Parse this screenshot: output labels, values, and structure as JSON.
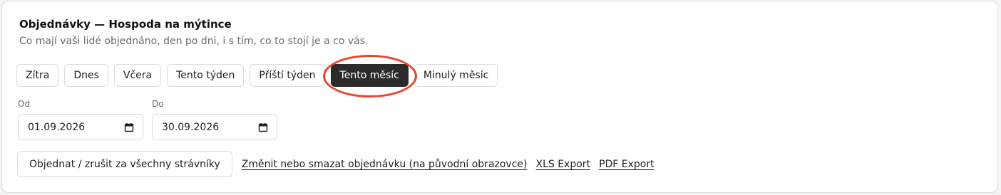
{
  "header": {
    "title": "Objednávky — Hospoda na mýtince",
    "subtitle": "Co mají vaši lidé objednáno, den po dni, i s tím, co to stojí je a co vás."
  },
  "presets": [
    {
      "label": "Zítra",
      "active": false
    },
    {
      "label": "Dnes",
      "active": false
    },
    {
      "label": "Včera",
      "active": false
    },
    {
      "label": "Tento týden",
      "active": false
    },
    {
      "label": "Příští týden",
      "active": false
    },
    {
      "label": "Tento měsíc",
      "active": true
    },
    {
      "label": "Minulý měsíc",
      "active": false
    }
  ],
  "date_range": {
    "from_label": "Od",
    "from_value": "01.09.2026",
    "to_label": "Do",
    "to_value": "30.09.2026"
  },
  "actions": {
    "order_all_label": "Objednat / zrušit za všechny strávníky",
    "change_link": "Změnit nebo smazat objednávku (na původní obrazovce)",
    "xls_link": "XLS Export",
    "pdf_link": "PDF Export"
  },
  "colors": {
    "active_preset_bg": "#2b2b2b",
    "highlight_ring": "#e8452c",
    "border": "#dcdcdf"
  }
}
